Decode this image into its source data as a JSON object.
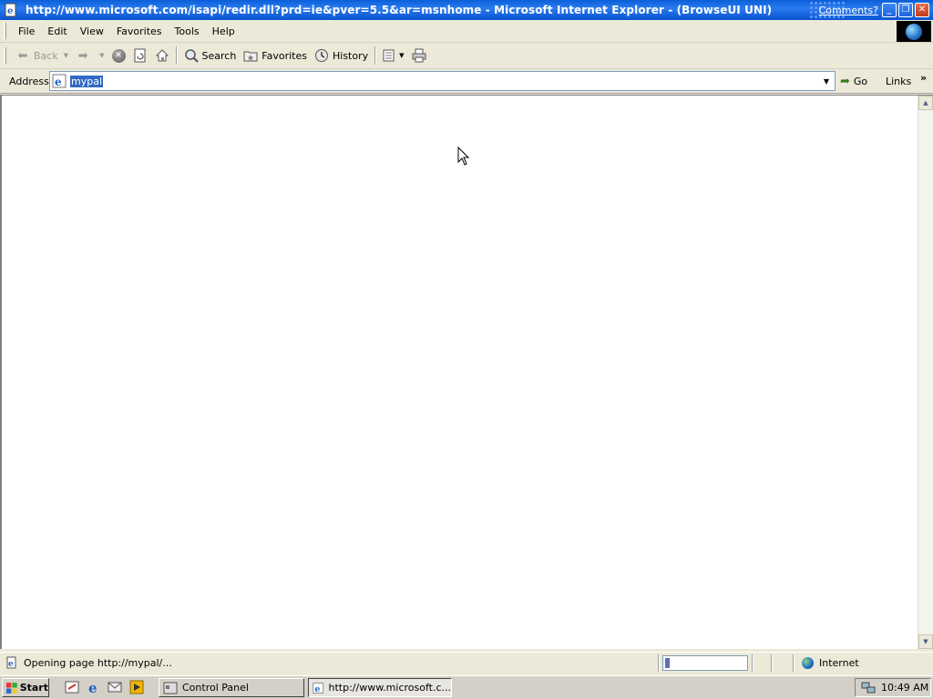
{
  "window": {
    "title": "http://www.microsoft.com/isapi/redir.dll?prd=ie&pver=5.5&ar=msnhome - Microsoft Internet Explorer - (BrowseUI UNI)",
    "comments_link": "Comments?",
    "minimize": "_",
    "restore": "❐",
    "close": "✕"
  },
  "menu": {
    "items": [
      "File",
      "Edit",
      "View",
      "Favorites",
      "Tools",
      "Help"
    ]
  },
  "toolbar": {
    "back_label": "Back",
    "search_label": "Search",
    "favorites_label": "Favorites",
    "history_label": "History"
  },
  "address": {
    "label": "Address",
    "value": "mypal",
    "go_label": "Go",
    "links_label": "Links",
    "links_chevron": "»"
  },
  "status": {
    "text": "Opening page http://mypal/...",
    "progress": 0.06,
    "zone": "Internet"
  },
  "taskbar": {
    "start_label": "Start",
    "tasks": [
      {
        "label": "Control Panel",
        "active": false
      },
      {
        "label": "http://www.microsoft.c...",
        "active": true
      }
    ],
    "clock": "10:49 AM"
  },
  "colors": {
    "titlebar": "#0a5fd8",
    "selection": "#316ac5",
    "chrome": "#ece9d8"
  }
}
